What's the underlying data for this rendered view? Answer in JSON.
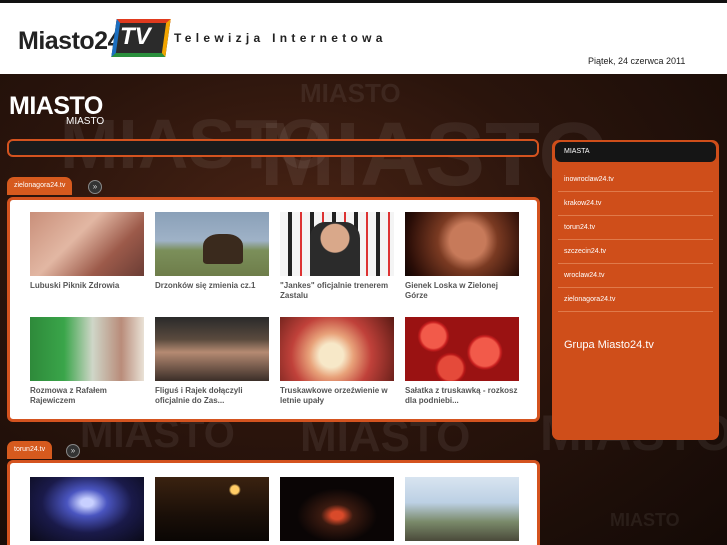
{
  "header": {
    "logo_text": "Miasto24.",
    "logo_box_text": "TV",
    "tagline": "Telewizja Internetowa",
    "date": "Piątek, 24 czerwca 2011"
  },
  "stage_logo": {
    "big": "MIASTO",
    "small": "MIASTO"
  },
  "watermarks": [
    "MIASTO",
    "MIASTO",
    "MIASTO",
    "MIASTO",
    "MIASTO",
    "MIASTO",
    "MIASTO"
  ],
  "sections": [
    {
      "tab": "zielonagora24.tv",
      "arrow": "»",
      "videos": [
        {
          "title": "Lubuski Piknik Zdrowia"
        },
        {
          "title": "Drzonków się zmienia cz.1"
        },
        {
          "title": "\"Jankes\" oficjalnie trenerem Zastalu"
        },
        {
          "title": "Gienek Loska w Zielonej Górze"
        },
        {
          "title": "Rozmowa z Rafałem Rajewiczem"
        },
        {
          "title": "Fliguś i Rajek dołączyli oficjalnie do Zas..."
        },
        {
          "title": "Truskawkowe orzeźwienie w letnie upały"
        },
        {
          "title": "Sałatka z truskawką - rozkosz dla podniebi..."
        }
      ]
    },
    {
      "tab": "torun24.tv",
      "arrow": "»",
      "videos": [
        {
          "title": ""
        },
        {
          "title": ""
        },
        {
          "title": ""
        },
        {
          "title": ""
        }
      ]
    }
  ],
  "sidebar": {
    "heading": "MIASTA",
    "items": [
      {
        "label": "inowroclaw24.tv"
      },
      {
        "label": "krakow24.tv"
      },
      {
        "label": "torun24.tv"
      },
      {
        "label": "szczecin24.tv"
      },
      {
        "label": "wroclaw24.tv"
      },
      {
        "label": "zielonagora24.tv"
      }
    ],
    "footer": "Grupa Miasto24.tv"
  },
  "colors": {
    "accent": "#d4531f",
    "header_bg": "#ffffff",
    "sidebar_head": "#151515"
  }
}
